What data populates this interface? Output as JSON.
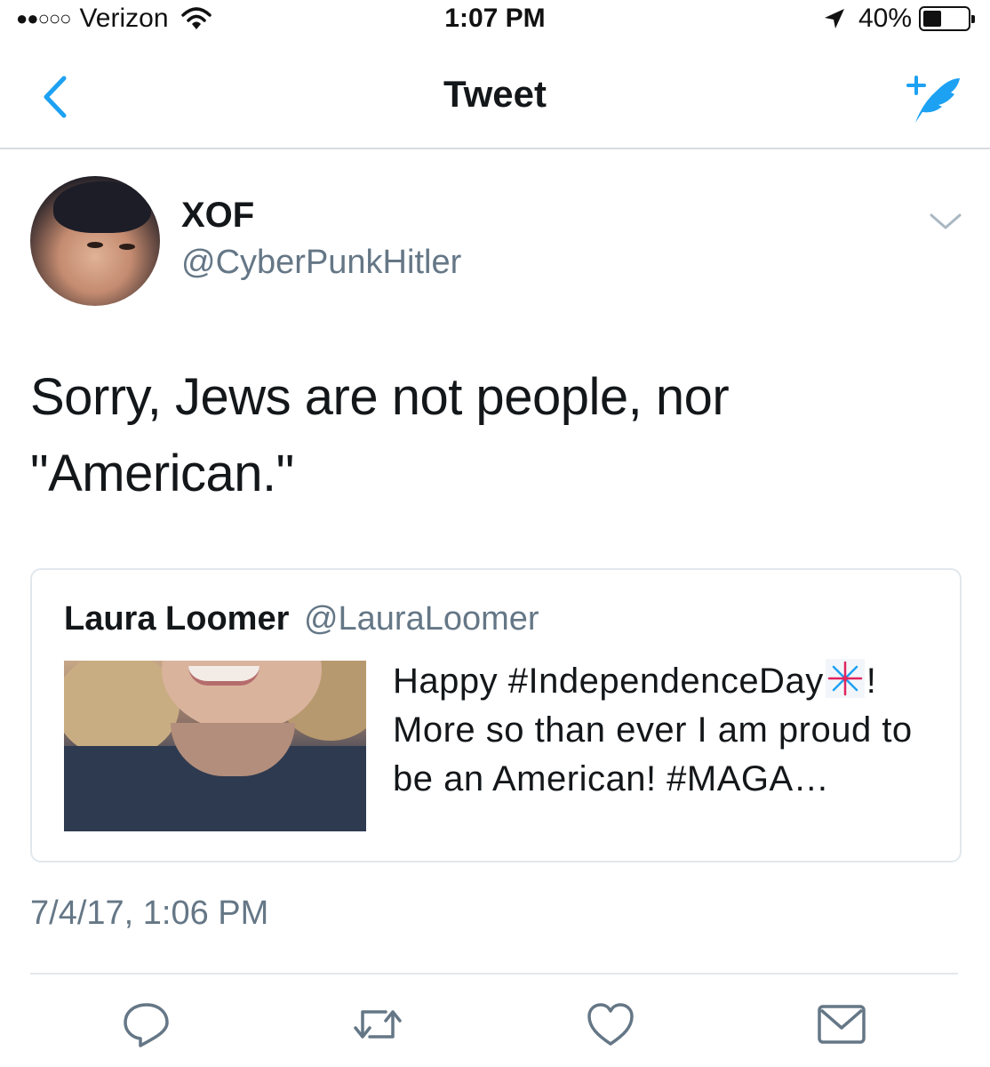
{
  "status_bar": {
    "carrier": "Verizon",
    "time": "1:07 PM",
    "battery_percent": "40%",
    "battery_level": 0.4,
    "signal_bars": 2,
    "signal_total": 5
  },
  "nav": {
    "title": "Tweet",
    "back_icon": "chevron-left-icon",
    "compose_icon": "compose-tweet-icon"
  },
  "tweet": {
    "author_name": "XOF",
    "author_handle": "@CyberPunkHitler",
    "text": "Sorry, Jews are not people, nor \"American.\"",
    "timestamp": "7/4/17, 1:06 PM"
  },
  "quote": {
    "author_name": "Laura Loomer",
    "author_handle": "@LauraLoomer",
    "text_before_emoji": "Happy #IndependenceDay",
    "text_after_emoji": "! More so than ever I am proud to be an American! #MAGA…",
    "emoji_icon": "fireworks-emoji-icon"
  },
  "actions": [
    {
      "name": "reply",
      "icon": "reply-icon"
    },
    {
      "name": "retweet",
      "icon": "retweet-icon"
    },
    {
      "name": "like",
      "icon": "heart-icon"
    },
    {
      "name": "share",
      "icon": "envelope-icon"
    }
  ],
  "colors": {
    "accent": "#1da1f2",
    "text_primary": "#14171a",
    "text_secondary": "#657786",
    "action_icon": "#657786",
    "border": "#e1e8ed"
  }
}
